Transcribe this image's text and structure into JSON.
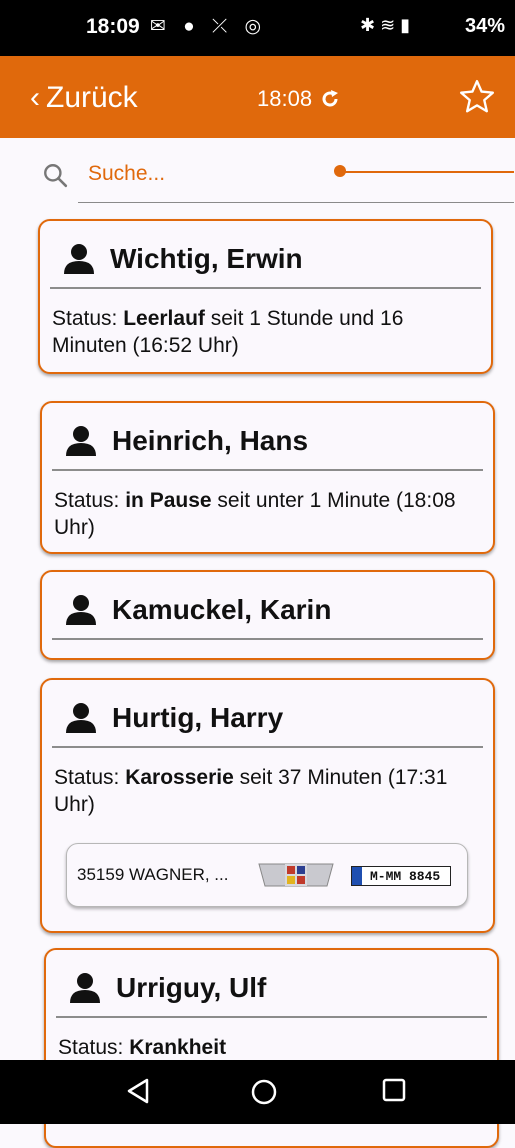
{
  "status_bar": {
    "time": "18:09",
    "icons": [
      "mail-icon",
      "bde-icon",
      "missed-call-icon",
      "sync-icon",
      "bluetooth-icon",
      "wifi-icon",
      "signal-icon"
    ],
    "battery": "34%"
  },
  "app_bar": {
    "back_label": "Zurück",
    "time": "18:08",
    "accent": "#e0690c"
  },
  "search": {
    "placeholder": "Suche..."
  },
  "employees": [
    {
      "name": "Wichtig, Erwin",
      "status_prefix": "Status: ",
      "status_value": "Leerlauf",
      "status_suffix": " seit 1 Stunde und 16 Minuten (16:52 Uhr)"
    },
    {
      "name": "Heinrich, Hans",
      "status_prefix": "Status: ",
      "status_value": "in Pause",
      "status_suffix": " seit unter 1 Minute (18:08 Uhr)"
    },
    {
      "name": "Kamuckel, Karin"
    },
    {
      "name": "Hurtig, Harry",
      "status_prefix": "Status: ",
      "status_value": "Karosserie",
      "status_suffix": " seit 37 Minuten (17:31 Uhr)",
      "vehicle": {
        "text": "35159  WAGNER, ...",
        "plate": "M-MM 8845"
      }
    },
    {
      "name": "Urriguy, Ulf",
      "status_prefix": "Status: ",
      "status_value": "Krankheit",
      "status_suffix": ""
    }
  ]
}
